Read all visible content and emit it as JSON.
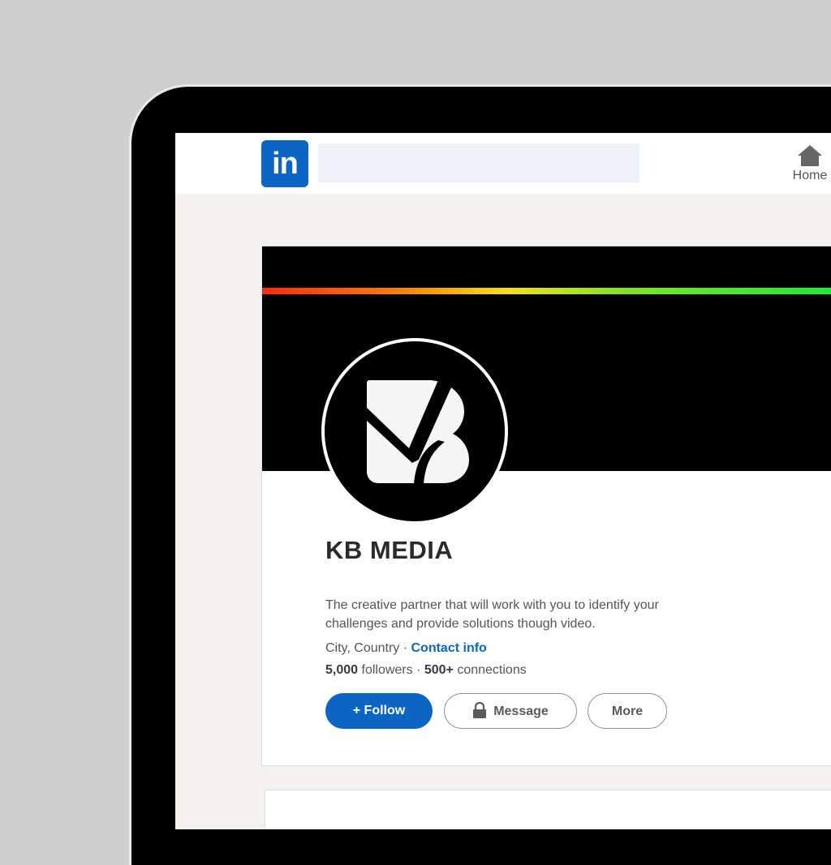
{
  "header": {
    "logo_text": "in",
    "search": {
      "placeholder": "",
      "value": ""
    },
    "nav": {
      "home_label": "Home"
    }
  },
  "profile": {
    "name": "KB MEDIA",
    "tagline": "The creative partner that will work with you to identify your challenges and provide solutions though video.",
    "location": "City, Country",
    "separator": " · ",
    "contact_info_label": "Contact info",
    "followers_count": "5,000",
    "followers_label": " followers",
    "connections_count": "500+",
    "connections_label": " connections"
  },
  "actions": {
    "follow_label": "+ Follow",
    "message_label": "Message",
    "more_label": "More"
  },
  "colors": {
    "brand_blue": "#0a66c2",
    "banner": "#000000",
    "page_background": "#f3f2ef"
  },
  "icons": {
    "home": "home-icon",
    "lock": "lock-icon",
    "logo": "kb-media-logo"
  }
}
